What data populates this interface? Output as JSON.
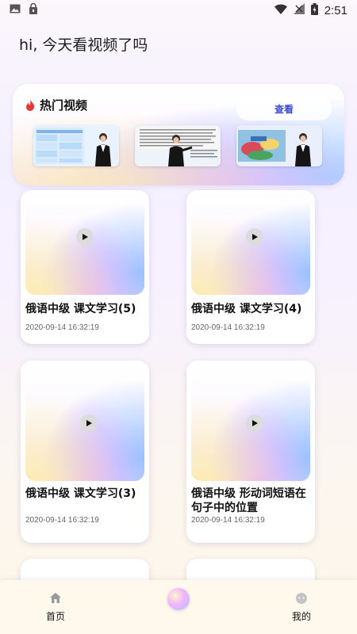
{
  "status_bar": {
    "time": "2:51"
  },
  "greeting": "hi, 今天看视频了吗",
  "hot": {
    "title": "热门视频",
    "view_label": "查看"
  },
  "videos": [
    {
      "title": "俄语中级 课文学习(5)",
      "date": "2020-09-14 16:32:19"
    },
    {
      "title": "俄语中级 课文学习(4)",
      "date": "2020-09-14 16:32:19"
    },
    {
      "title": "俄语中级 课文学习(3)",
      "date": "2020-09-14 16:32:19"
    },
    {
      "title": "俄语中级 形动词短语在句子中的位置",
      "date": "2020-09-14 16:32:19"
    }
  ],
  "nav": {
    "home": "首页",
    "mine": "我的"
  },
  "colors": {
    "accent": "#3b4bd1",
    "flame": "#e53935"
  }
}
